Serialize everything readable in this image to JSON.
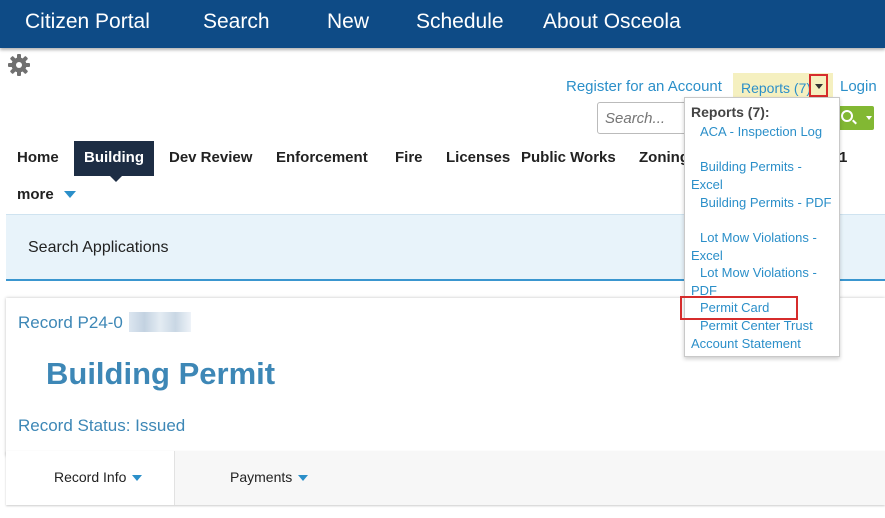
{
  "topnav": {
    "items": [
      {
        "label": "Citizen Portal"
      },
      {
        "label": "Search"
      },
      {
        "label": "New"
      },
      {
        "label": "Schedule"
      },
      {
        "label": "About Osceola"
      }
    ]
  },
  "header": {
    "register_label": "Register for an Account",
    "reports_label": "Reports (7)",
    "login_label": "Login",
    "search_placeholder": "Search..."
  },
  "module_tabs": {
    "items": [
      "Home",
      "Building",
      "Dev Review",
      "Enforcement",
      "Fire",
      "Licenses",
      "Public Works",
      "Zoning",
      "1"
    ],
    "active": "Building",
    "more_label": "more"
  },
  "search_apps": {
    "label": "Search Applications"
  },
  "record": {
    "number_prefix": "Record P24-0",
    "type": "Building Permit",
    "status": "Record Status: Issued"
  },
  "record_tabs": {
    "items": [
      {
        "label": "Record Info"
      },
      {
        "label": "Payments"
      }
    ]
  },
  "reports_menu": {
    "header": "Reports (7):",
    "items": [
      "ACA - Inspection Log",
      "Building Permits - Excel",
      "Building Permits - PDF",
      "Lot Mow Violations - Excel",
      "Lot Mow Violations - PDF",
      "Permit Card",
      "Permit Center Trust Account Statement"
    ]
  },
  "colors": {
    "nav_bg": "#0e4b86",
    "active_tab_bg": "#1d2d44",
    "link": "#2b8fc9",
    "record_text": "#3d87b6",
    "search_button": "#82b833",
    "reports_bg": "#f5f0c0",
    "annotation_red": "#d62c2c"
  }
}
